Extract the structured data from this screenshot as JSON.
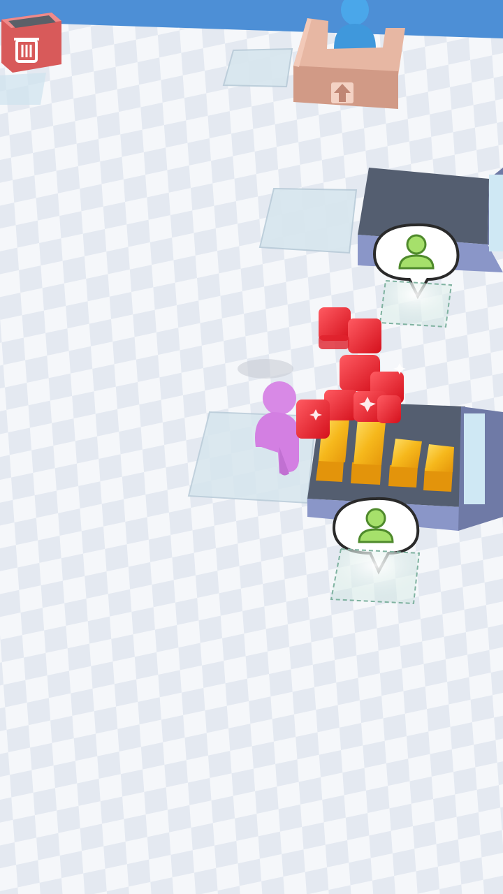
{
  "game": {
    "title": "",
    "colors": {
      "background_sky": "#4d8fd6",
      "floor_light": "#f5f7fa",
      "floor_dark": "#e3e8f0",
      "player": "#d889e6",
      "npc": "#4aa7ea",
      "customer_icon": "#a6e06b",
      "trash_bin": "#e86a6a",
      "red_cube": "#e8232e",
      "gold_bar": "#f4b41a",
      "counter_top": "#545e70",
      "counter_side": "#8a96c8",
      "desk": "#d8a58f"
    },
    "icons": {
      "trash": "trash-icon",
      "up_arrow": "up-arrow-icon",
      "customer": "customer-icon"
    },
    "stack_counts": {
      "red_cubes": 9,
      "gold_bars": 4
    }
  }
}
